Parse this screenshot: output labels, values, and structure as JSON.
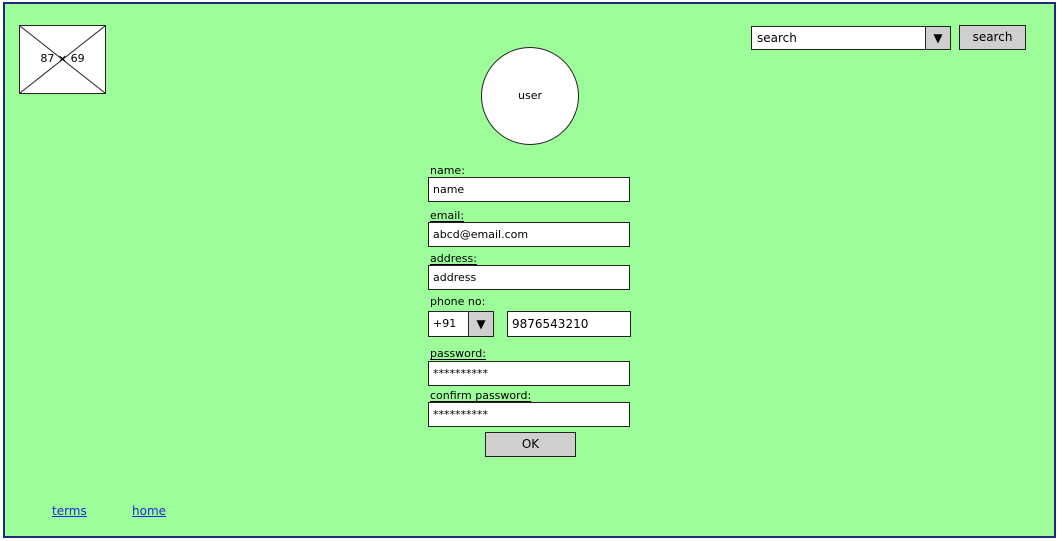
{
  "logo": {
    "placeholder": "87 × 69"
  },
  "header": {
    "search_value": "search",
    "search_arrow": "▼",
    "search_button": "search"
  },
  "avatar": {
    "label": "user"
  },
  "form": {
    "name_label": "name:",
    "name_value": "name",
    "email_label": "email:",
    "email_value": "abcd@email.com",
    "address_label": "address:",
    "address_value": "address",
    "phone_label": "phone no:",
    "phone_code": "+91",
    "phone_code_arrow": "▼",
    "phone_value": "9876543210",
    "password_label": "password:",
    "password_value": "**********",
    "confirm_label": "confirm password:",
    "confirm_value": "**********",
    "ok_label": "OK"
  },
  "footer": {
    "terms": "terms",
    "home": "home"
  }
}
